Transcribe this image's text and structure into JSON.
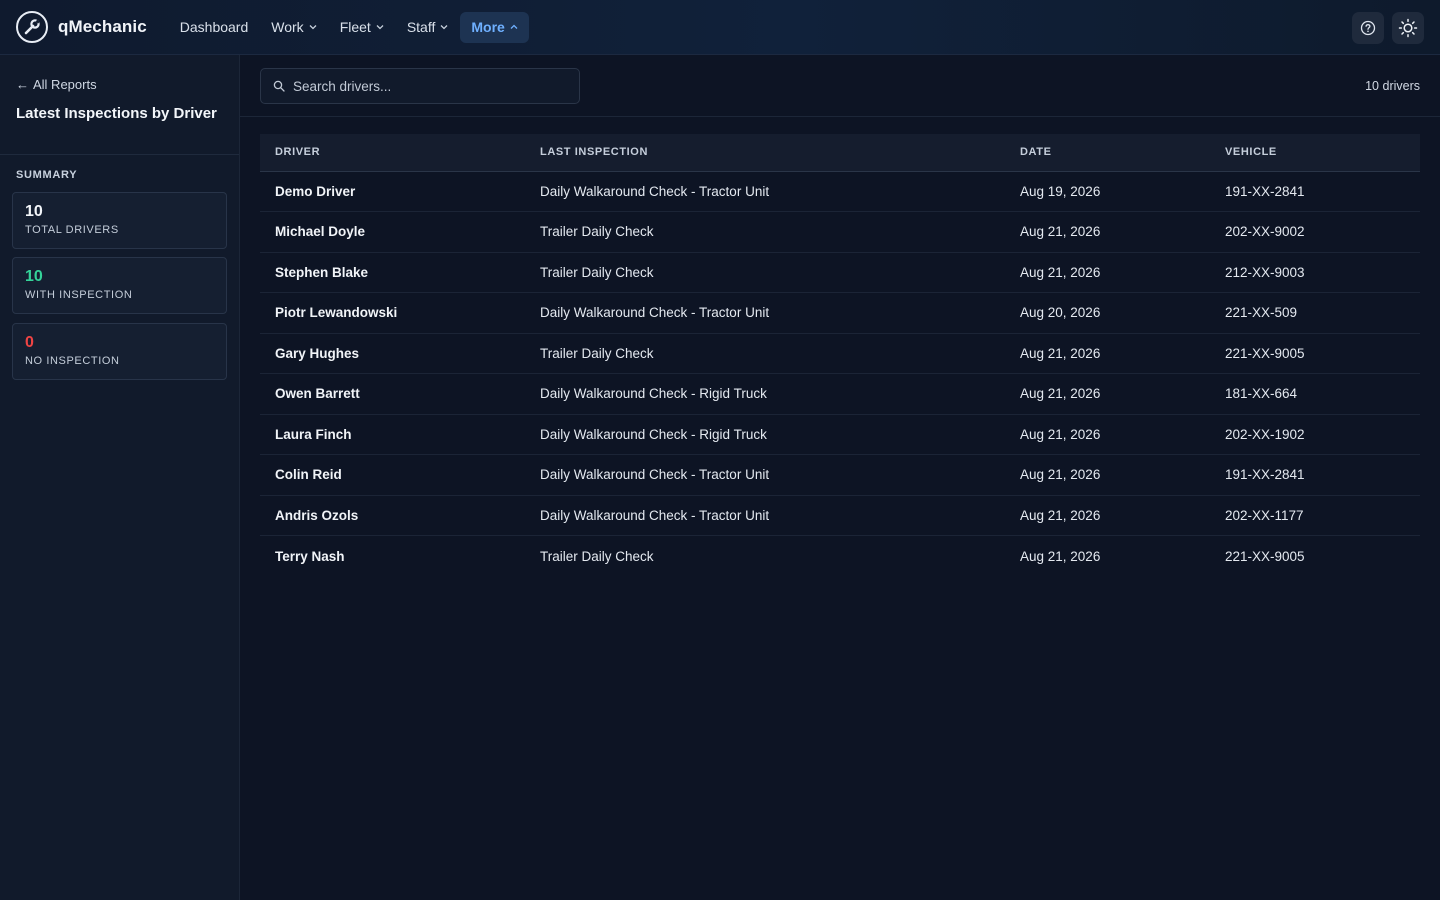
{
  "app": {
    "name": "qMechanic"
  },
  "nav": [
    {
      "label": "Dashboard",
      "dropdown": false,
      "active": false
    },
    {
      "label": "Work",
      "dropdown": true,
      "active": false
    },
    {
      "label": "Fleet",
      "dropdown": true,
      "active": false
    },
    {
      "label": "Staff",
      "dropdown": true,
      "active": false
    },
    {
      "label": "More",
      "dropdown": true,
      "active": true
    }
  ],
  "header_actions": {
    "help_icon": "help-circle-icon",
    "theme_icon": "sun-icon"
  },
  "sidebar": {
    "back_label": "All Reports",
    "title": "Latest Inspections by Driver",
    "summary_label": "SUMMARY",
    "stats": [
      {
        "value": "10",
        "label": "TOTAL DRIVERS",
        "color": "#f2f5f9"
      },
      {
        "value": "10",
        "label": "WITH INSPECTION",
        "color": "#34d399"
      },
      {
        "value": "0",
        "label": "NO INSPECTION",
        "color": "#ef4444"
      }
    ]
  },
  "search": {
    "placeholder": "Search drivers..."
  },
  "count_label": "10 drivers",
  "table": {
    "columns": [
      "DRIVER",
      "LAST INSPECTION",
      "DATE",
      "VEHICLE"
    ],
    "rows": [
      [
        "Demo Driver",
        "Daily Walkaround Check - Tractor Unit",
        "Aug 19, 2026",
        "191-XX-2841"
      ],
      [
        "Michael Doyle",
        "Trailer Daily Check",
        "Aug 21, 2026",
        "202-XX-9002"
      ],
      [
        "Stephen Blake",
        "Trailer Daily Check",
        "Aug 21, 2026",
        "212-XX-9003"
      ],
      [
        "Piotr Lewandowski",
        "Daily Walkaround Check - Tractor Unit",
        "Aug 20, 2026",
        "221-XX-509"
      ],
      [
        "Gary Hughes",
        "Trailer Daily Check",
        "Aug 21, 2026",
        "221-XX-9005"
      ],
      [
        "Owen Barrett",
        "Daily Walkaround Check - Rigid Truck",
        "Aug 21, 2026",
        "181-XX-664"
      ],
      [
        "Laura Finch",
        "Daily Walkaround Check - Rigid Truck",
        "Aug 21, 2026",
        "202-XX-1902"
      ],
      [
        "Colin Reid",
        "Daily Walkaround Check - Tractor Unit",
        "Aug 21, 2026",
        "191-XX-2841"
      ],
      [
        "Andris Ozols",
        "Daily Walkaround Check - Tractor Unit",
        "Aug 21, 2026",
        "202-XX-1177"
      ],
      [
        "Terry Nash",
        "Trailer Daily Check",
        "Aug 21, 2026",
        "221-XX-9005"
      ]
    ]
  }
}
